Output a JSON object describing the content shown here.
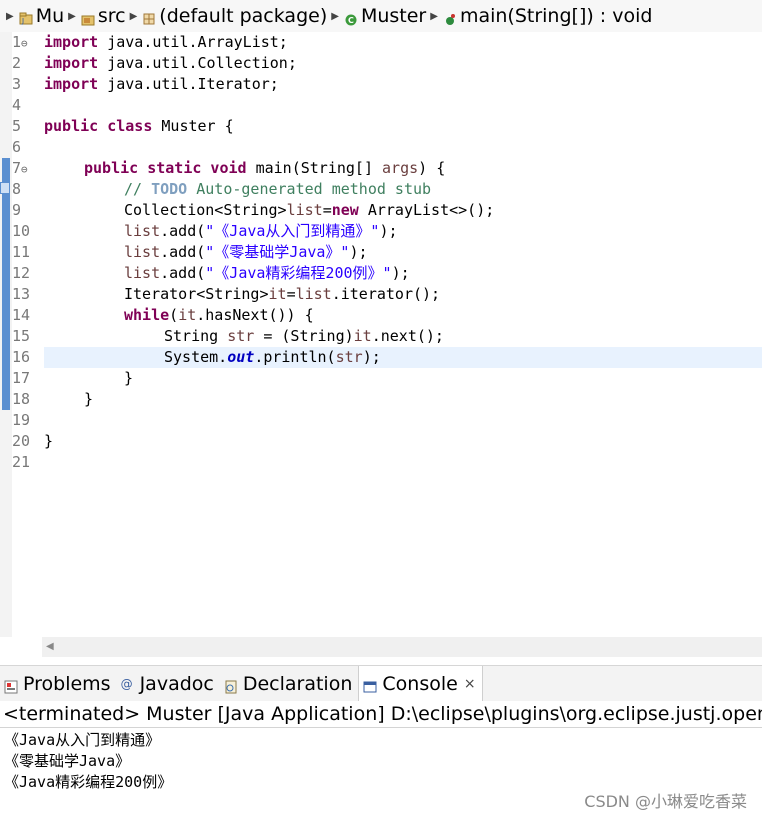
{
  "breadcrumb": [
    {
      "label": "Mu",
      "icon": "project-icon"
    },
    {
      "label": "src",
      "icon": "source-folder-icon"
    },
    {
      "label": "(default package)",
      "icon": "package-icon"
    },
    {
      "label": "Muster",
      "icon": "class-icon"
    },
    {
      "label": "main(String[]) : void",
      "icon": "method-icon"
    }
  ],
  "editor": {
    "line_numbers": [
      "1",
      "2",
      "3",
      "4",
      "5",
      "6",
      "7",
      "8",
      "9",
      "10",
      "11",
      "12",
      "13",
      "14",
      "15",
      "16",
      "17",
      "18",
      "19",
      "20",
      "21"
    ],
    "current_line": "16",
    "code": {
      "l1_kw": "import",
      "l1_rest": " java.util.ArrayList;",
      "l2_kw": "import",
      "l2_rest": " java.util.Collection;",
      "l3_kw": "import",
      "l3_rest": " java.util.Iterator;",
      "l5_kw": "public class",
      "l5_rest": " Muster {",
      "l7_kw": "public static void",
      "l7_a": " main(String[] ",
      "l7_var": "args",
      "l7_b": ") {",
      "l8_a": "// ",
      "l8_todo": "TODO",
      "l8_b": " Auto-generated method stub",
      "l9_a": "Collection<String>",
      "l9_var": "list",
      "l9_b": "=",
      "l9_kw": "new",
      "l9_c": " ArrayList<>();",
      "l10_var": "list",
      "l10_a": ".add(",
      "l10_str": "\"《Java从入门到精通》\"",
      "l10_b": ");",
      "l11_var": "list",
      "l11_a": ".add(",
      "l11_str": "\"《零基础学Java》\"",
      "l11_b": ");",
      "l12_var": "list",
      "l12_a": ".add(",
      "l12_str": "\"《Java精彩编程200例》\"",
      "l12_b": ");",
      "l13_a": "Iterator<String>",
      "l13_var": "it",
      "l13_b": "=",
      "l13_var2": "list",
      "l13_c": ".iterator();",
      "l14_kw": "while",
      "l14_a": "(",
      "l14_var": "it",
      "l14_b": ".hasNext()) {",
      "l15_a": "String ",
      "l15_var": "str",
      "l15_b": " = (String)",
      "l15_var2": "it",
      "l15_c": ".next();",
      "l16_a": "System.",
      "l16_fld": "out",
      "l16_b": ".println(",
      "l16_var": "str",
      "l16_c": ");",
      "l17": "}",
      "l18": "}",
      "l20": "}"
    }
  },
  "bottom_panel": {
    "tabs": [
      {
        "label": "Problems",
        "icon": "problems-icon"
      },
      {
        "label": "Javadoc",
        "icon": "javadoc-icon"
      },
      {
        "label": "Declaration",
        "icon": "declaration-icon"
      },
      {
        "label": "Console",
        "icon": "console-icon",
        "active": true
      }
    ],
    "close_glyph": "×",
    "status": "<terminated> Muster [Java Application] D:\\eclipse\\plugins\\org.eclipse.justj.open",
    "output": [
      "《Java从入门到精通》",
      "《零基础学Java》",
      "《Java精彩编程200例》"
    ]
  },
  "watermark": "CSDN @小琳爱吃香菜"
}
